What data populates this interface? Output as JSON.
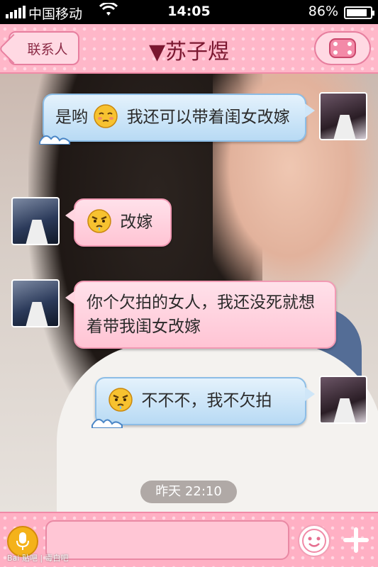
{
  "status_bar": {
    "carrier": "中国移动",
    "time": "14:05",
    "battery_percent": "86%",
    "battery_level": 0.86,
    "wifi_icon": "wifi-icon"
  },
  "header": {
    "back_label": "联系人",
    "title": "▼苏子煜",
    "menu_icon": "menu-icon"
  },
  "messages": [
    {
      "side": "right",
      "style": "blue",
      "emoji": "shy-face",
      "text_before": "是哟",
      "text_after": "我还可以带着闺女改嫁"
    },
    {
      "side": "left",
      "style": "pink",
      "emoji": "angry-face",
      "text_before": "",
      "text_after": "改嫁"
    },
    {
      "side": "left",
      "style": "pink",
      "emoji": "",
      "text_before": "你个欠拍的女人，我还没死就想着带我闺女改嫁",
      "text_after": ""
    },
    {
      "side": "right",
      "style": "blue",
      "emoji": "angry-face",
      "text_before": "",
      "text_after": "不不不，我不欠拍"
    }
  ],
  "timestamp": "昨天 22:10",
  "input": {
    "value": "",
    "placeholder": ""
  },
  "watermark": "Bai 贴吧 | 毒白吧",
  "colors": {
    "header_pink": "#ffb7c9",
    "bubble_blue": "#b8daf4",
    "bubble_pink": "#ffc4d4"
  }
}
